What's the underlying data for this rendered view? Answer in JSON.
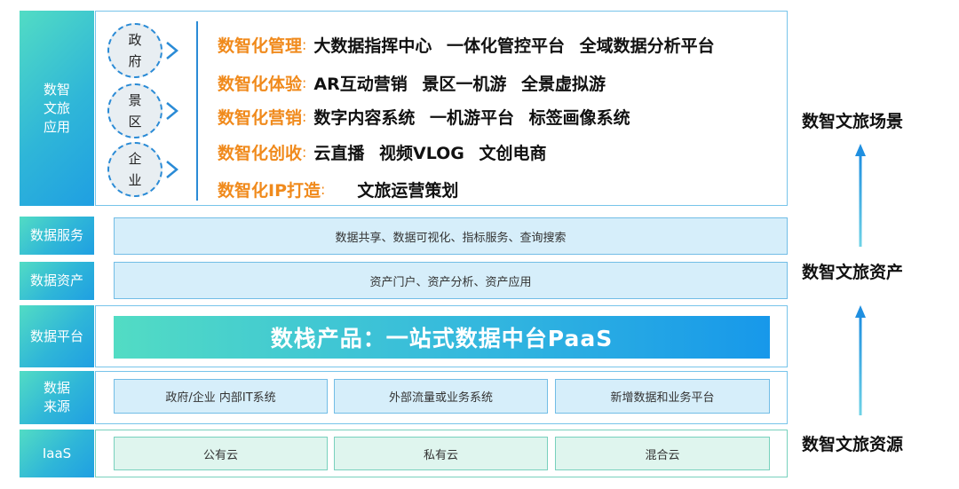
{
  "layers": {
    "app": {
      "label_lines": [
        "数智",
        "文旅",
        "应用"
      ],
      "circles": [
        {
          "line1": "政",
          "line2": "府"
        },
        {
          "line1": "景",
          "line2": "区"
        },
        {
          "line1": "企",
          "line2": "业"
        }
      ],
      "rows": [
        {
          "category": "数智化管理",
          "sep": ":",
          "items": "大数据指挥中心 一体化管控平台 全域数据分析平台"
        },
        {
          "category": "数智化体验",
          "sep": ":",
          "items": "AR互动营销 景区一机游 全景虚拟游"
        },
        {
          "category": "数智化营销",
          "sep": ":",
          "items": "数字内容系统 一机游平台 标签画像系统"
        },
        {
          "category": "数智化创收",
          "sep": ":",
          "items": "云直播 视频VLOG 文创电商"
        },
        {
          "category": "数智化IP打造",
          "sep": ":",
          "items": "文旅运营策划"
        }
      ]
    },
    "service": {
      "label": "数据服务",
      "content": "数据共享、数据可视化、指标服务、查询搜索"
    },
    "asset": {
      "label": "数据资产",
      "content": "资产门户、资产分析、资产应用"
    },
    "platform": {
      "label": "数据平台",
      "content": "数栈产品：一站式数据中台PaaS"
    },
    "source": {
      "label_lines": [
        "数据",
        "来源"
      ],
      "items": [
        "政府/企业 内部IT系统",
        "外部流量或业务系统",
        "新增数据和业务平台"
      ]
    },
    "iaas": {
      "label": "IaaS",
      "items": [
        "公有云",
        "私有云",
        "混合云"
      ]
    }
  },
  "right_labels": {
    "scene": "数智文旅场景",
    "asset": "数智文旅资产",
    "resource": "数智文旅资源"
  },
  "colors": {
    "accent_orange": "#f08a1c",
    "accent_blue": "#2a8bd6",
    "gradient_start": "#52dcc4",
    "gradient_end": "#1798ea"
  }
}
